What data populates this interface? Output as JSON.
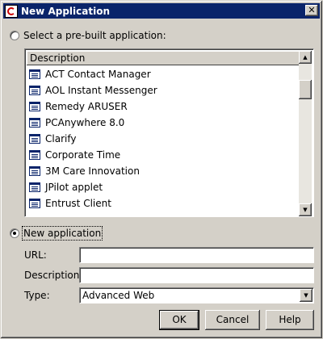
{
  "window": {
    "title": "New Application",
    "close_glyph": "✕"
  },
  "prebuilt_option": {
    "label": "Select a pre-built application:",
    "selected": false
  },
  "app_list": {
    "column_header": "Description",
    "items": [
      {
        "label": "ACT Contact Manager",
        "icon": "application-icon"
      },
      {
        "label": "AOL Instant Messenger",
        "icon": "application-icon"
      },
      {
        "label": "Remedy ARUSER",
        "icon": "application-icon"
      },
      {
        "label": "PCAnywhere 8.0",
        "icon": "application-icon"
      },
      {
        "label": "Clarify",
        "icon": "application-icon"
      },
      {
        "label": "Corporate Time",
        "icon": "application-icon"
      },
      {
        "label": "3M Care Innovation",
        "icon": "application-icon"
      },
      {
        "label": "JPilot applet",
        "icon": "application-icon"
      },
      {
        "label": "Entrust Client",
        "icon": "application-icon"
      }
    ],
    "scroll_up_glyph": "▲",
    "scroll_down_glyph": "▼"
  },
  "new_option": {
    "label": "New application",
    "selected": true
  },
  "form": {
    "url_label": "URL:",
    "url_value": "",
    "description_label": "Description:",
    "description_value": "",
    "type_label": "Type:",
    "type_value": "Advanced Web",
    "dropdown_glyph": "▼"
  },
  "buttons": {
    "ok": "OK",
    "cancel": "Cancel",
    "help": "Help"
  },
  "colors": {
    "titlebar": "#0a246a",
    "face": "#d4d0c8"
  }
}
